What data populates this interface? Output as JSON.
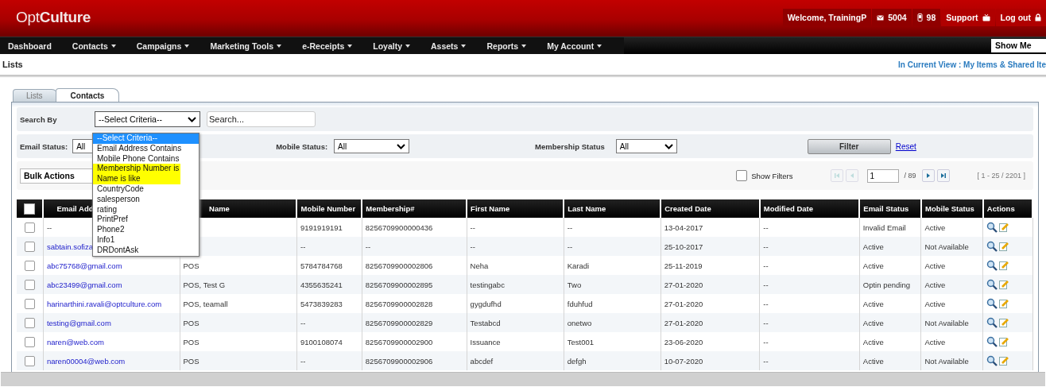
{
  "header": {
    "logo": "Opt**Culture**",
    "welcome": "Welcome, TrainingP",
    "email_credits": "5004",
    "sms_credits": "98",
    "support": "Support",
    "logout": "Log out"
  },
  "nav": {
    "items": [
      {
        "label": "Dashboard",
        "has_menu": false
      },
      {
        "label": "Contacts",
        "has_menu": true
      },
      {
        "label": "Campaigns",
        "has_menu": true
      },
      {
        "label": "Marketing Tools",
        "has_menu": true
      },
      {
        "label": "e-Receipts",
        "has_menu": true
      },
      {
        "label": "Loyalty",
        "has_menu": true
      },
      {
        "label": "Assets",
        "has_menu": true
      },
      {
        "label": "Reports",
        "has_menu": true
      },
      {
        "label": "My Account",
        "has_menu": true
      }
    ],
    "show_me": "Show Me"
  },
  "page_title": "Lists",
  "view_filter": "In Current View : My Items & Shared Ite",
  "tabs": [
    {
      "label": "Lists",
      "selected": false
    },
    {
      "label": "Contacts",
      "selected": true
    }
  ],
  "search": {
    "label": "Search By",
    "criteria": "--Select Criteria--",
    "placeholder": "Search...",
    "options": [
      {
        "label": "--Select Criteria--",
        "selected": true,
        "highlighted": false
      },
      {
        "label": "Email Address Contains",
        "selected": false,
        "highlighted": false
      },
      {
        "label": "Mobile Phone Contains",
        "selected": false,
        "highlighted": false
      },
      {
        "label": "Membership Number is",
        "selected": false,
        "highlighted": true
      },
      {
        "label": "Name is like",
        "selected": false,
        "highlighted": true
      },
      {
        "label": "CountryCode",
        "selected": false,
        "highlighted": false
      },
      {
        "label": "salesperson",
        "selected": false,
        "highlighted": false
      },
      {
        "label": "rating",
        "selected": false,
        "highlighted": false
      },
      {
        "label": "PrintPref",
        "selected": false,
        "highlighted": false
      },
      {
        "label": "Phone2",
        "selected": false,
        "highlighted": false
      },
      {
        "label": "Info1",
        "selected": false,
        "highlighted": false
      },
      {
        "label": "DRDontAsk",
        "selected": false,
        "highlighted": false
      }
    ]
  },
  "filters": {
    "email_status_label": "Email Status:",
    "email_status": "All",
    "mobile_status_label": "Mobile Status:",
    "mobile_status": "All",
    "membership_status_label": "Membership Status",
    "membership_status": "All",
    "filter_button": "Filter",
    "reset": "Reset"
  },
  "toolbar": {
    "bulk_actions": "Bulk Actions",
    "show_filters": "Show Filters",
    "show_filters_checked": false,
    "page": "1",
    "page_total": "/ 89",
    "range": "[ 1 - 25 / 2201 ]",
    "first_disabled": true,
    "prev_disabled": true
  },
  "table": {
    "select_all_checked": false,
    "columns": [
      "Email Add",
      "Name",
      "Mobile Number",
      "Membership#",
      "First Name",
      "Last Name",
      "Created Date",
      "Modified Date",
      "Email Status",
      "Mobile Status",
      "Actions"
    ],
    "rows": [
      {
        "checked": false,
        "email": "--",
        "email_link": false,
        "list": "",
        "mobile": "9191919191",
        "membership": "8256709900000436",
        "first": "--",
        "last": "--",
        "created": "13-04-2017",
        "modified": "--",
        "email_status": "Invalid Email",
        "mobile_status": "Active"
      },
      {
        "checked": false,
        "email": "sabtain.sofiza",
        "email_link": true,
        "list": "",
        "mobile": "--",
        "membership": "--",
        "first": "--",
        "last": "--",
        "created": "25-10-2017",
        "modified": "--",
        "email_status": "Active",
        "mobile_status": "Not Available"
      },
      {
        "checked": false,
        "email": "abc75768@gmail.com",
        "email_link": true,
        "list": "POS",
        "mobile": "5784784768",
        "membership": "8256709900002806",
        "first": "Neha",
        "last": "Karadi",
        "created": "25-11-2019",
        "modified": "--",
        "email_status": "Active",
        "mobile_status": "Active"
      },
      {
        "checked": false,
        "email": "abc23499@gmail.com",
        "email_link": true,
        "list": "POS, Test G",
        "mobile": "4355635241",
        "membership": "8256709900002895",
        "first": "testingabc",
        "last": "Two",
        "created": "27-01-2020",
        "modified": "--",
        "email_status": "Optin pending",
        "mobile_status": "Active"
      },
      {
        "checked": false,
        "email": "harinarthini.ravali@optculture.com",
        "email_link": true,
        "list": "POS, teamall",
        "mobile": "5473839283",
        "membership": "8256709900002828",
        "first": "gygdufhd",
        "last": "fduhfud",
        "created": "27-01-2020",
        "modified": "--",
        "email_status": "Active",
        "mobile_status": "Active"
      },
      {
        "checked": false,
        "email": "testing@gmail.com",
        "email_link": true,
        "list": "POS",
        "mobile": "--",
        "membership": "8256709900002829",
        "first": "Testabcd",
        "last": "onetwo",
        "created": "27-01-2020",
        "modified": "--",
        "email_status": "Active",
        "mobile_status": "Not Available"
      },
      {
        "checked": false,
        "email": "naren@web.com",
        "email_link": true,
        "list": "POS",
        "mobile": "9100108074",
        "membership": "8256709900002900",
        "first": "Issuance",
        "last": "Test001",
        "created": "23-06-2020",
        "modified": "--",
        "email_status": "Active",
        "mobile_status": "Active"
      },
      {
        "checked": false,
        "email": "naren00004@web.com",
        "email_link": true,
        "list": "POS",
        "mobile": "--",
        "membership": "8256709900002906",
        "first": "abcdef",
        "last": "defgh",
        "created": "10-07-2020",
        "modified": "--",
        "email_status": "Active",
        "mobile_status": "Not Available"
      }
    ]
  }
}
